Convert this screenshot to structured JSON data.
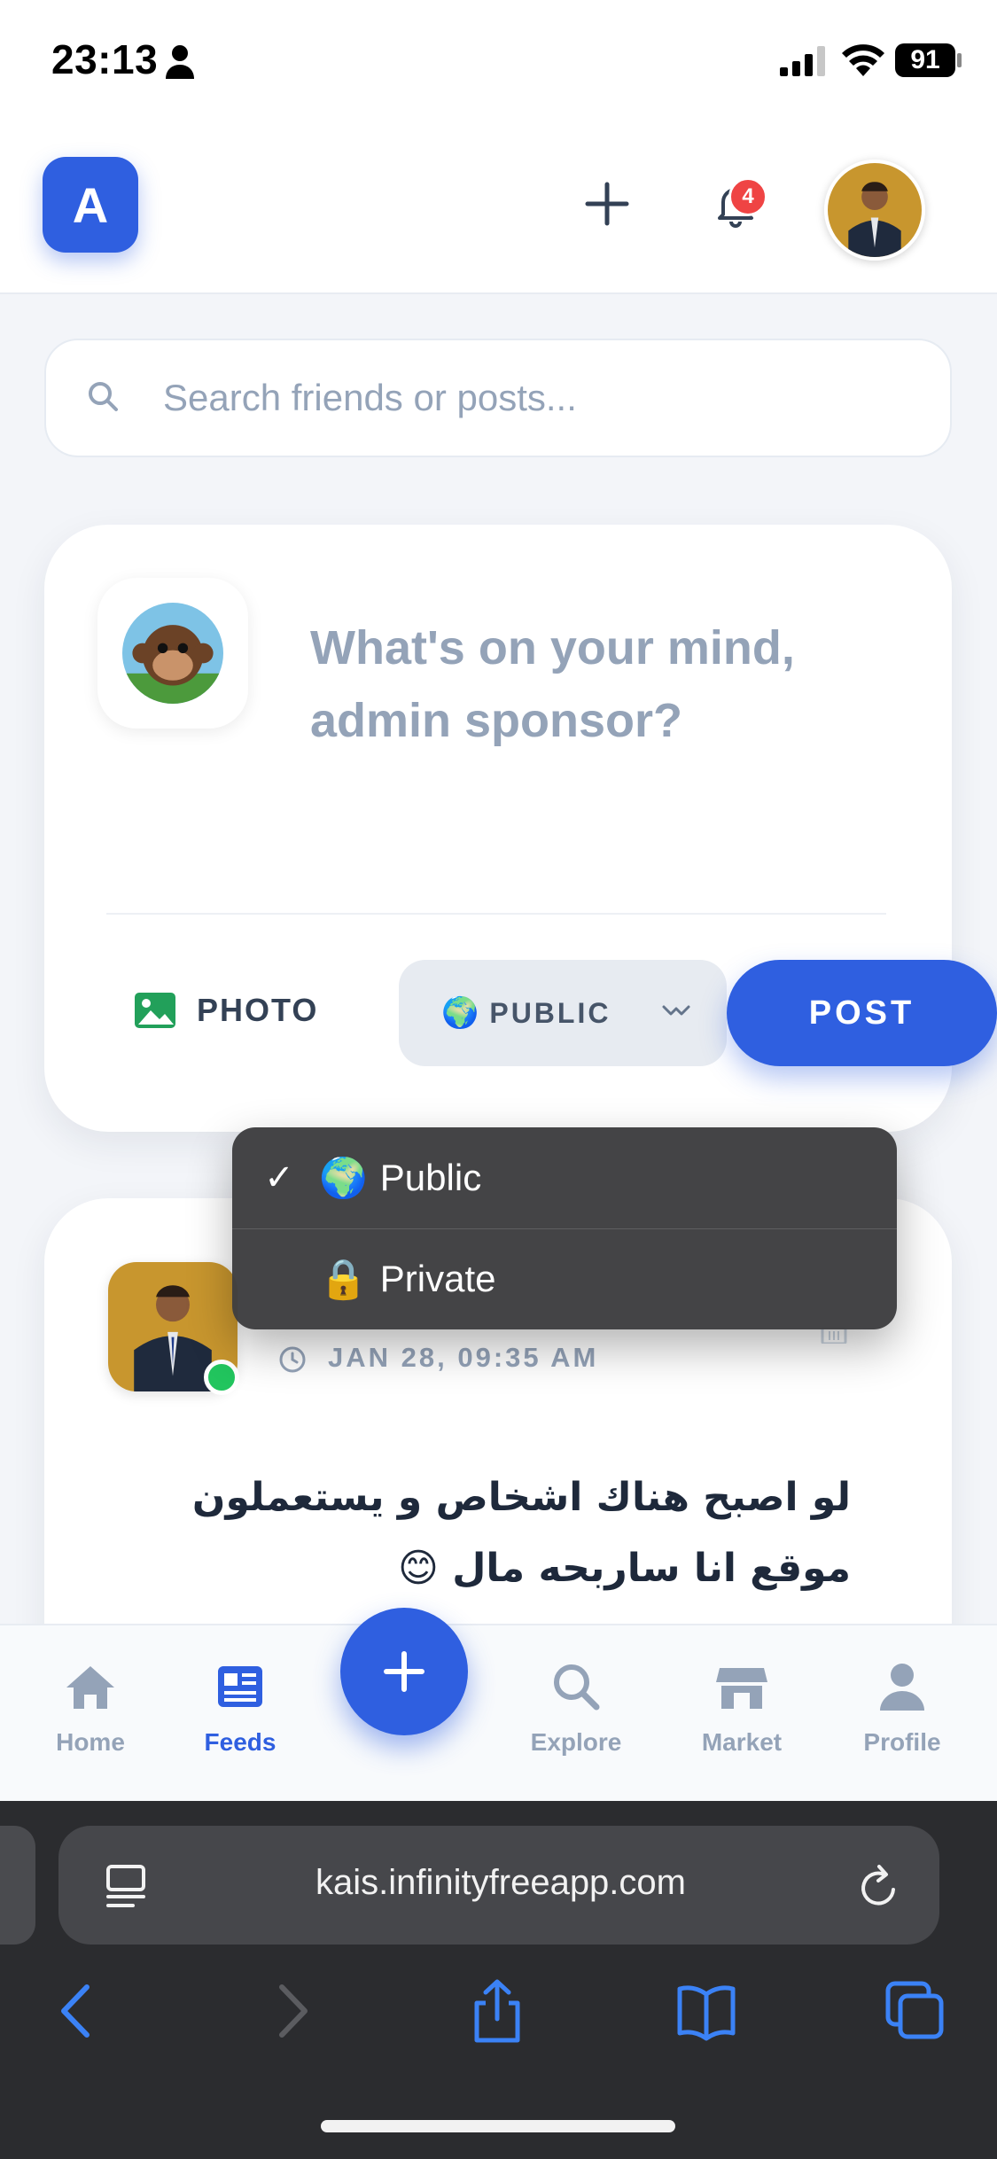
{
  "status_bar": {
    "time": "23:13",
    "battery": "91"
  },
  "header": {
    "logo_letter": "A",
    "notification_count": "4"
  },
  "search": {
    "placeholder": "Search friends or posts..."
  },
  "composer": {
    "prompt": "What's on your mind, admin sponsor?",
    "photo_label": "PHOTO",
    "privacy_label": "PUBLIC",
    "privacy_emoji": "🌍",
    "post_label": "POST"
  },
  "privacy_dropdown": {
    "options": [
      {
        "label": "Public",
        "emoji": "🌍",
        "selected": true
      },
      {
        "label": "Private",
        "emoji": "🔒",
        "selected": false
      }
    ],
    "check": "✓"
  },
  "post": {
    "timestamp": "JAN 28, 09:35 AM",
    "text": "لو اصبح هناك اشخاص و يستعملون موقع انا ساربحه مال 😊"
  },
  "bottom_nav": {
    "items": [
      {
        "label": "Home",
        "icon": "home-icon",
        "active": false
      },
      {
        "label": "Feeds",
        "icon": "feeds-icon",
        "active": true
      },
      {
        "label": "Explore",
        "icon": "search-icon",
        "active": false
      },
      {
        "label": "Market",
        "icon": "store-icon",
        "active": false
      },
      {
        "label": "Profile",
        "icon": "person-icon",
        "active": false
      }
    ]
  },
  "browser": {
    "url": "kais.infinityfreeapp.com"
  },
  "colors": {
    "accent": "#2f5fe0",
    "badge": "#ef4444",
    "online": "#22c55e",
    "muted": "#94a3b8"
  }
}
